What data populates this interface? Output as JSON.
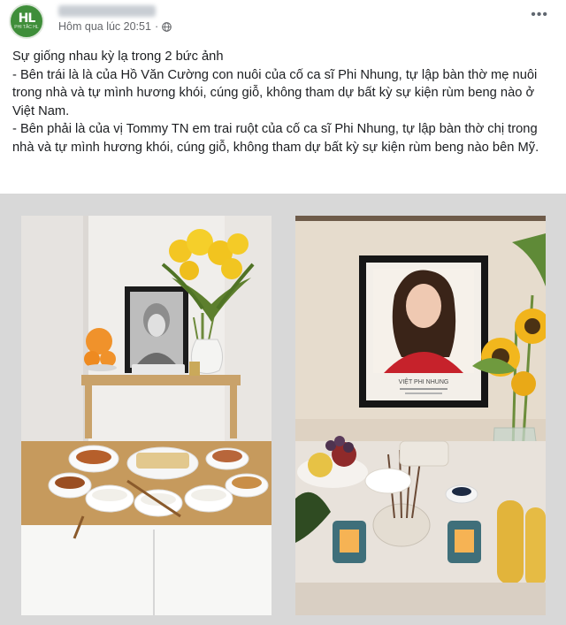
{
  "post": {
    "avatar_text": "HL",
    "avatar_subtext": "PHI TẮC HL",
    "time": "Hôm qua lúc 20:51",
    "privacy_icon": "globe-icon",
    "more_icon": "more-options-icon",
    "paragraphs": [
      "Sự giống nhau kỳ lạ trong 2 bức ảnh",
      "- Bên trái là là của Hồ Văn Cường con nuôi của cố ca sĩ Phi Nhung, tự lập bàn thờ mẹ nuôi trong nhà và tự mình hương khói, cúng giỗ, không tham dự bất kỳ sự kiện rùm beng nào ở Việt Nam.",
      "- Bên phải là của vị Tommy TN em trai ruột của cố ca sĩ Phi Nhung, tự lập bàn thờ chị trong nhà và tự mình hương khói, cúng giỗ, không tham dự bất kỳ sự kiện rùm beng nào bên Mỹ."
    ]
  },
  "photos": {
    "right_portrait_caption": "VIỆT PHI NHUNG"
  }
}
